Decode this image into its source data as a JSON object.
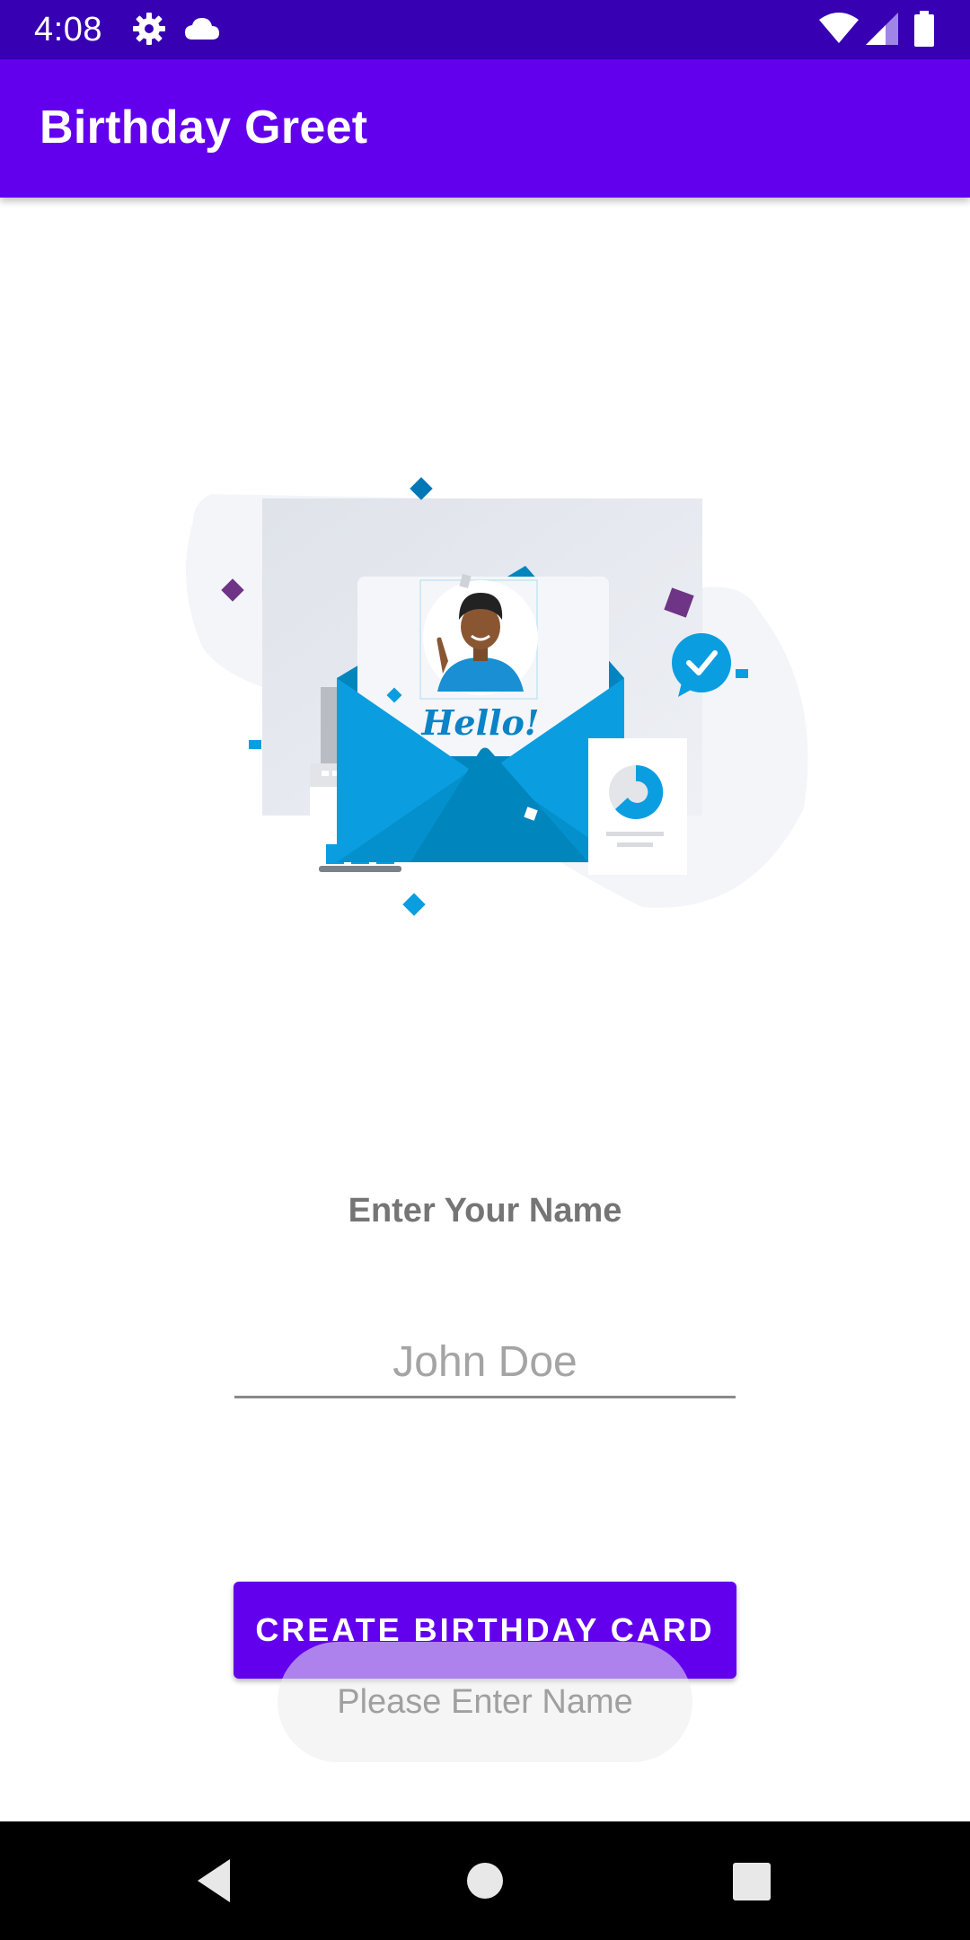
{
  "status_bar": {
    "time": "4:08",
    "icons": [
      "gear-icon",
      "cloud-icon",
      "wifi-icon",
      "signal-icon",
      "battery-icon"
    ]
  },
  "app_bar": {
    "title": "Birthday Greet",
    "color": "#6200ee",
    "status_color": "#3700b3"
  },
  "illustration": {
    "greeting": "Hello!"
  },
  "form": {
    "label": "Enter Your Name",
    "name_input": {
      "placeholder": "John Doe",
      "value": ""
    },
    "create_button_label": "CREATE BIRTHDAY CARD"
  },
  "toast": {
    "message": "Please Enter Name"
  },
  "nav_bar": {
    "buttons": [
      "back-icon",
      "home-icon",
      "recents-icon"
    ]
  }
}
